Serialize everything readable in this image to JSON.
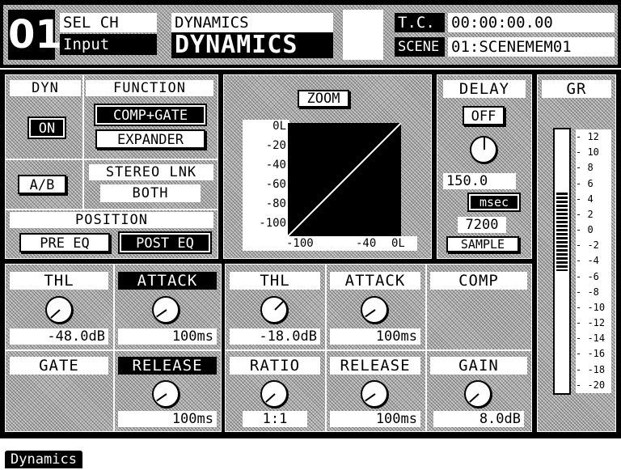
{
  "header": {
    "channel_number": "01",
    "sel_ch_label": "SEL CH",
    "channel_name": "Input",
    "dynamics_small": "DYNAMICS",
    "dynamics_big": "DYNAMICS",
    "tc_label": "T.C.",
    "tc_value": "00:00:00.00",
    "scene_label": "SCENE",
    "scene_value": "01:SCENEMEM01"
  },
  "dyn": {
    "dyn_label": "DYN",
    "on_button": "ON",
    "function_label": "FUNCTION",
    "comp_gate_button": "COMP+GATE",
    "expander_button": "EXPANDER",
    "ab_button": "A/B",
    "stereo_link_label": "STEREO LNK",
    "stereo_link_value": "BOTH",
    "position_label": "POSITION",
    "pre_eq_button": "PRE EQ",
    "post_eq_button": "POST EQ"
  },
  "graph": {
    "zoom_button": "ZOOM",
    "y_ticks": [
      "0L",
      "-20",
      "-40",
      "-60",
      "-80",
      "-100"
    ],
    "x_ticks": [
      "-100",
      "-40",
      "0L"
    ]
  },
  "delay": {
    "title": "DELAY",
    "off_button": "OFF",
    "time_value": "150.0",
    "unit_button": "msec",
    "samples_value": "7200",
    "sample_button": "SAMPLE"
  },
  "gr_meter": {
    "title": "GR",
    "scale": [
      "12",
      "10",
      "8",
      "6",
      "4",
      "2",
      "0",
      "-2",
      "-4",
      "-6",
      "-8",
      "-10",
      "-12",
      "-14",
      "-16",
      "-18",
      "-20"
    ],
    "level_db": 4
  },
  "gate": {
    "thl_label": "THL",
    "thl_value": "-48.0dB",
    "attack_label": "ATTACK",
    "attack_value": "100ms",
    "gate_label": "GATE",
    "release_label": "RELEASE",
    "release_value": "100ms"
  },
  "comp": {
    "thl_label": "THL",
    "thl_value": "-18.0dB",
    "attack_label": "ATTACK",
    "attack_value": "100ms",
    "comp_label": "COMP",
    "ratio_label": "RATIO",
    "ratio_value": "1:1",
    "release_label": "RELEASE",
    "release_value": "100ms",
    "gain_label": "GAIN",
    "gain_value": "8.0dB"
  },
  "footer": {
    "tab_label": "Dynamics"
  }
}
